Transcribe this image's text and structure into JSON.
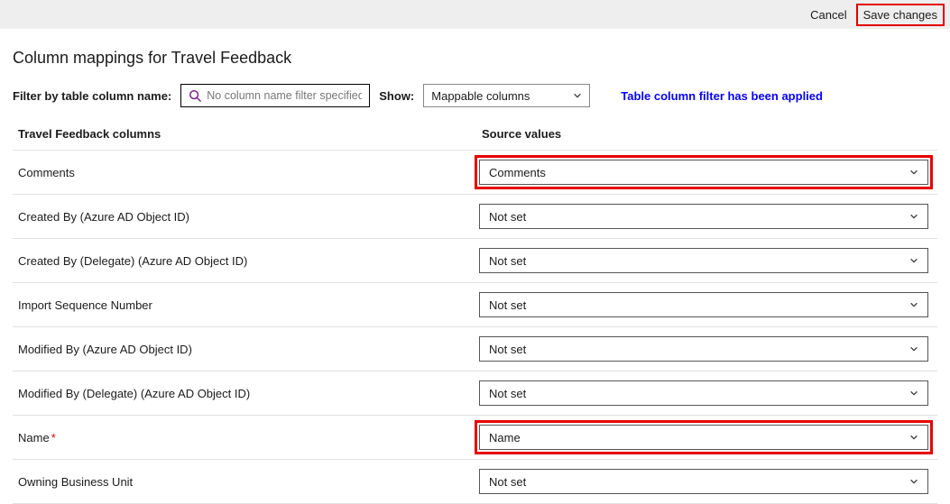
{
  "topbar": {
    "cancel": "Cancel",
    "save": "Save changes"
  },
  "title": "Column mappings for Travel Feedback",
  "filter": {
    "label": "Filter by table column name:",
    "placeholder": "No column name filter specified",
    "show_label": "Show:",
    "show_value": "Mappable columns",
    "notice": "Table column filter has been applied"
  },
  "headers": {
    "left": "Travel Feedback columns",
    "right": "Source values"
  },
  "rows": [
    {
      "label": "Comments",
      "required": false,
      "value": "Comments",
      "highlighted": true
    },
    {
      "label": "Created By (Azure AD Object ID)",
      "required": false,
      "value": "Not set",
      "highlighted": false
    },
    {
      "label": "Created By (Delegate) (Azure AD Object ID)",
      "required": false,
      "value": "Not set",
      "highlighted": false
    },
    {
      "label": "Import Sequence Number",
      "required": false,
      "value": "Not set",
      "highlighted": false
    },
    {
      "label": "Modified By (Azure AD Object ID)",
      "required": false,
      "value": "Not set",
      "highlighted": false
    },
    {
      "label": "Modified By (Delegate) (Azure AD Object ID)",
      "required": false,
      "value": "Not set",
      "highlighted": false
    },
    {
      "label": "Name",
      "required": true,
      "value": "Name",
      "highlighted": true
    },
    {
      "label": "Owning Business Unit",
      "required": false,
      "value": "Not set",
      "highlighted": false
    }
  ]
}
